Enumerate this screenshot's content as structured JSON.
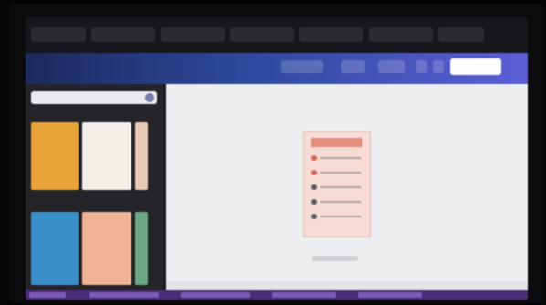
{
  "browser": {
    "tabs": [],
    "address": ""
  },
  "toolbar": {
    "items": [],
    "share_label": ""
  },
  "left_panel": {
    "search_placeholder": "",
    "section1_title": "",
    "section2_title": ""
  },
  "canvas": {
    "page_title": "",
    "page_number_label": ""
  },
  "taskbar": {
    "items": []
  },
  "colors": {
    "toolbar_start": "#1b2a5e",
    "toolbar_end": "#5b5fd6",
    "page_bg": "#f6dcd4",
    "taskbar": "#4a2d7a"
  }
}
